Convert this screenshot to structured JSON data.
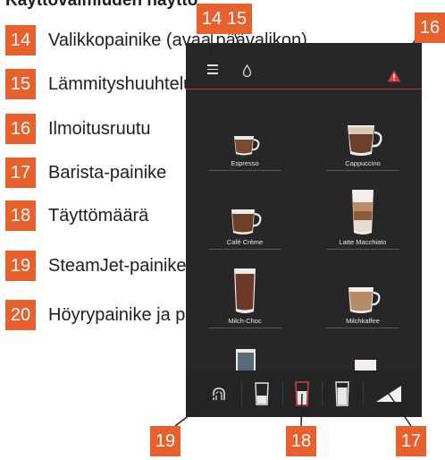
{
  "heading": "Käyttövalmiuden näyttö",
  "legend": [
    {
      "number": "14",
      "label": "Valikkopainike (avaa päävalikon)"
    },
    {
      "number": "15",
      "label": "Lämmityshuuhtelupainike"
    },
    {
      "number": "16",
      "label": "Ilmoitusruutu"
    },
    {
      "number": "17",
      "label": "Barista-painike"
    },
    {
      "number": "18",
      "label": "Täyttömäärä"
    },
    {
      "number": "19",
      "label": "SteamJet-painike"
    },
    {
      "number": "20",
      "label": "Höyrypainike ja pikavalinta"
    }
  ],
  "callouts": {
    "top_left": "14",
    "top_middle": "15",
    "top_right": "16",
    "bottom_left": "19",
    "bottom_middle": "18",
    "bottom_right": "17"
  },
  "screen": {
    "top_icons": [
      "menu-icon",
      "drop-icon",
      "warning-icon"
    ],
    "products": [
      {
        "label": "Espresso"
      },
      {
        "label": "Cappuccino"
      },
      {
        "label": "Café Crème"
      },
      {
        "label": "Latte Macchiato"
      },
      {
        "label": "Milch-Choc"
      },
      {
        "label": "Milchkaffee"
      }
    ],
    "bottom_icons": [
      "steamjet-icon",
      "small-glass-icon",
      "medium-glass-icon",
      "large-glass-icon",
      "barista-wedge-icon"
    ]
  },
  "colors": {
    "accent": "#e8602c",
    "screen_bg": "#27272a",
    "separator_red": "#c0323a"
  }
}
